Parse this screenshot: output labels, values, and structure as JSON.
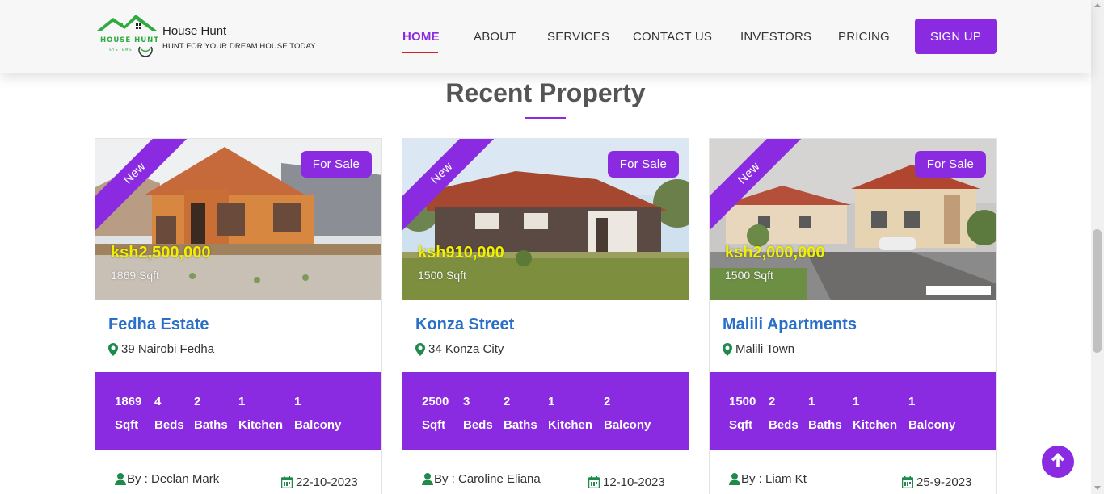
{
  "brand": {
    "name": "House Hunt",
    "tagline": "HUNT FOR YOUR DREAM HOUSE TODAY",
    "logo_text_top": "HOUSE HUNT",
    "logo_text_bottom": "SYSTEMS"
  },
  "nav": {
    "items": [
      {
        "label": "HOME",
        "active": true
      },
      {
        "label": "ABOUT",
        "active": false
      },
      {
        "label": "SERVICES",
        "active": false
      },
      {
        "label": "CONTACT US",
        "active": false
      },
      {
        "label": "INVESTORS",
        "active": false
      },
      {
        "label": "PRICING",
        "active": false
      }
    ],
    "signup_label": "SIGN UP"
  },
  "section": {
    "title": "Recent Property"
  },
  "colors": {
    "accent": "#8a2be2",
    "title_link": "#2a70c8",
    "price": "#f0f000",
    "nav_underline": "#d0202a"
  },
  "properties": [
    {
      "ribbon": "New",
      "status": "For Sale",
      "price": "ksh2,500,000",
      "area": "1869 Sqft",
      "title": "Fedha Estate",
      "location": "39 Nairobi Fedha",
      "features": [
        {
          "value": "1869",
          "label": "Sqft"
        },
        {
          "value": "4",
          "label": "Beds"
        },
        {
          "value": "2",
          "label": "Baths"
        },
        {
          "value": "1",
          "label": "Kitchen"
        },
        {
          "value": "1",
          "label": "Balcony"
        }
      ],
      "author": "By : Declan Mark",
      "date": "22-10-2023"
    },
    {
      "ribbon": "New",
      "status": "For Sale",
      "price": "ksh910,000",
      "area": "1500 Sqft",
      "title": "Konza Street",
      "location": "34 Konza City",
      "features": [
        {
          "value": "2500",
          "label": "Sqft"
        },
        {
          "value": "3",
          "label": "Beds"
        },
        {
          "value": "2",
          "label": "Baths"
        },
        {
          "value": "1",
          "label": "Kitchen"
        },
        {
          "value": "2",
          "label": "Balcony"
        }
      ],
      "author": "By : Caroline Eliana",
      "date": "12-10-2023"
    },
    {
      "ribbon": "New",
      "status": "For Sale",
      "price": "ksh2,000,000",
      "area": "1500 Sqft",
      "title": "Malili Apartments",
      "location": "Malili Town",
      "features": [
        {
          "value": "1500",
          "label": "Sqft"
        },
        {
          "value": "2",
          "label": "Beds"
        },
        {
          "value": "1",
          "label": "Baths"
        },
        {
          "value": "1",
          "label": "Kitchen"
        },
        {
          "value": "1",
          "label": "Balcony"
        }
      ],
      "author": "By : Liam Kt",
      "date": "25-9-2023"
    }
  ]
}
